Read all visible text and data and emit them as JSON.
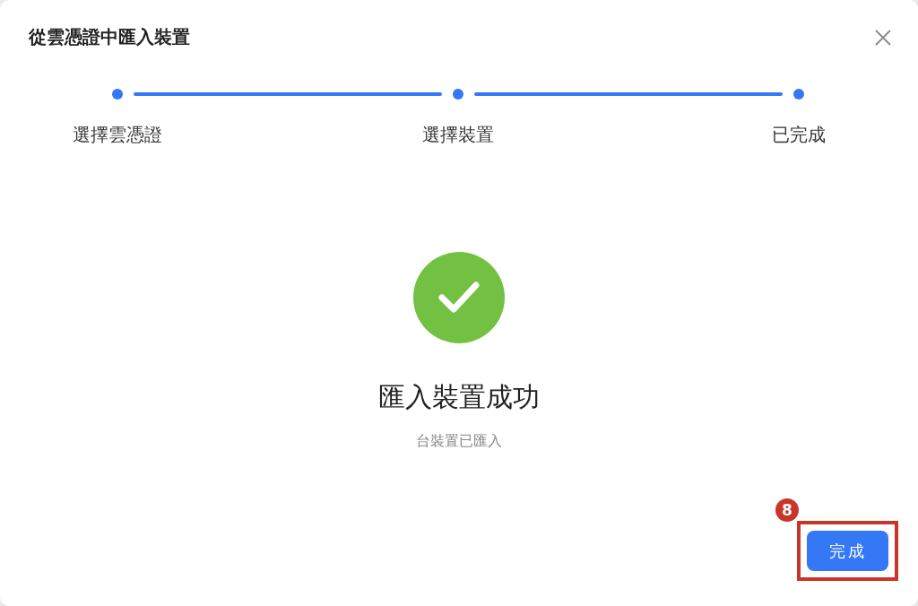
{
  "dialog": {
    "title": "從雲憑證中匯入裝置"
  },
  "steps": [
    {
      "label": "選擇雲憑證",
      "done": true
    },
    {
      "label": "選擇裝置",
      "done": true
    },
    {
      "label": "已完成",
      "done": true
    }
  ],
  "result": {
    "success": true,
    "heading": "匯入裝置成功",
    "message": "台裝置已匯入"
  },
  "footer": {
    "button": "完成",
    "annotation": {
      "badge": "8",
      "highlighted": true
    }
  }
}
